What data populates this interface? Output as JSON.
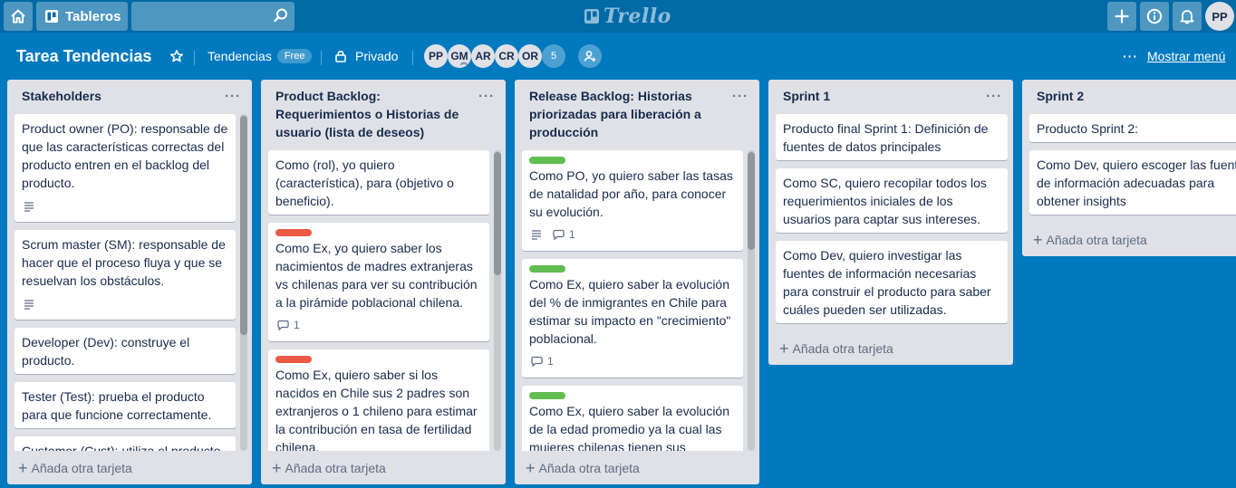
{
  "header": {
    "boards_label": "Tableros",
    "search_value": "",
    "logo_text": "Trello",
    "user_initials": "PP"
  },
  "board": {
    "title": "Tarea Tendencias",
    "team": "Tendencias",
    "team_plan": "Free",
    "visibility": "Privado",
    "members": [
      "PP",
      "GM",
      "AR",
      "CR",
      "OR"
    ],
    "members_extra": "5",
    "menu_label": "Mostrar menú"
  },
  "add_card_label": "Añada otra tarjeta",
  "lists": [
    {
      "title": "Stakeholders",
      "cards": [
        {
          "text": "Product owner (PO): responsable de que las características correctas del producto entren en el backlog del producto.",
          "has_description": true
        },
        {
          "text": "Scrum master (SM): responsable de hacer que el proceso fluya y que se resuelvan los obstáculos.",
          "has_description": true
        },
        {
          "text": "Developer (Dev): construye el producto."
        },
        {
          "text": "Tester (Test): prueba el producto para que funcione correctamente."
        },
        {
          "text": "Customer (Cust): utiliza el producto"
        }
      ]
    },
    {
      "title": "Product Backlog: Requerimientos o Historias de usuario (lista de deseos)",
      "cards": [
        {
          "text": "Como (rol), yo quiero (característica), para (objetivo o beneficio)."
        },
        {
          "label": "red",
          "text": "Como Ex, yo quiero saber los nacimientos de madres extranjeras vs chilenas para ver su contribución a la pirámide poblacional chilena.",
          "comments": "1"
        },
        {
          "label": "red",
          "text": "Como Ex, quiero saber si los nacidos en Chile sus 2 padres son extranjeros o 1 chileno para estimar la contribución en tasa de fertilidad chilena."
        }
      ]
    },
    {
      "title": "Release Backlog: Historias priorizadas para liberación a producción",
      "cards": [
        {
          "label": "green",
          "text": "Como PO, yo quiero saber las tasas de natalidad por año, para conocer su evolución.",
          "has_description": true,
          "comments": "1"
        },
        {
          "label": "green",
          "text": "Como Ex, quiero saber la evolución del % de inmigrantes en Chile para estimar su impacto en \"crecimiento\" poblacional.",
          "comments": "1"
        },
        {
          "label": "green",
          "text": "Como Ex, quiero saber la evolución de la edad promedio ya la cual las mujeres chilenas tienen sus"
        }
      ]
    },
    {
      "title": "Sprint 1",
      "cards": [
        {
          "text": "Producto final Sprint 1: Definición de fuentes de datos principales"
        },
        {
          "text": "Como SC, quiero recopilar todos los requerimientos iniciales de los usuarios para captar sus intereses."
        },
        {
          "text": "Como Dev, quiero investigar las fuentes de información necesarias para construir el producto para saber cuáles pueden ser utilizadas."
        }
      ]
    },
    {
      "title": "Sprint 2",
      "cards": [
        {
          "text": "Producto Sprint 2:"
        },
        {
          "text": "Como Dev, quiero escoger las fuentes de información adecuadas para obtener insights"
        }
      ]
    }
  ]
}
